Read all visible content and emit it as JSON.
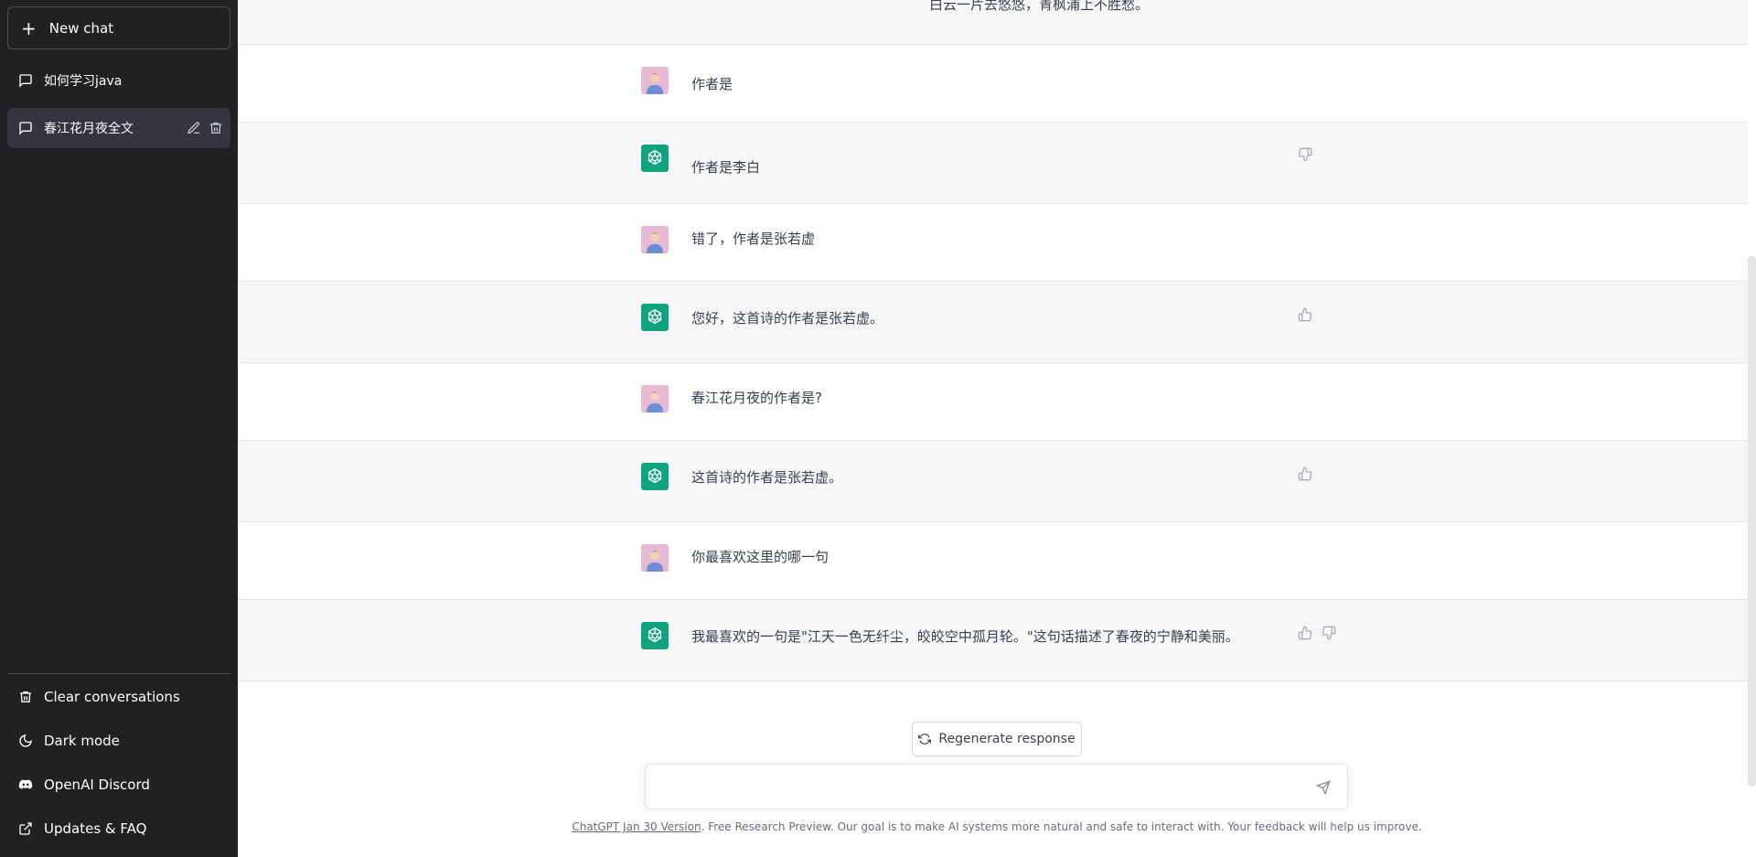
{
  "sidebar": {
    "new_chat_label": "New chat",
    "conversations": [
      {
        "label": "如何学习java"
      },
      {
        "label": "春江花月夜全文"
      }
    ],
    "bottom": [
      {
        "label": "Clear conversations",
        "icon": "trash-icon"
      },
      {
        "label": "Dark mode",
        "icon": "moon-icon"
      },
      {
        "label": "OpenAI Discord",
        "icon": "discord-icon"
      },
      {
        "label": "Updates & FAQ",
        "icon": "external-link-icon"
      }
    ]
  },
  "messages": [
    {
      "role": "user",
      "text": "作者是"
    },
    {
      "role": "assistant",
      "text": "作者是李白"
    },
    {
      "role": "user",
      "text": "错了，作者是张若虚"
    },
    {
      "role": "assistant",
      "text": "您好，这首诗的作者是张若虚。"
    },
    {
      "role": "user",
      "text": "春江花月夜的作者是?"
    },
    {
      "role": "assistant",
      "text": "这首诗的作者是张若虚。"
    },
    {
      "role": "user",
      "text": "你最喜欢这里的哪一句"
    },
    {
      "role": "assistant",
      "text": "我最喜欢的一句是\"江天一色无纤尘，皎皎空中孤月轮。\"这句话描述了春夜的宁静和美丽。"
    }
  ],
  "partial_top_text": "白云一片去悠悠，青枫浦上不胜愁。",
  "regenerate_label": "Regenerate response",
  "input": {
    "placeholder": ""
  },
  "footer": {
    "link_text": "ChatGPT Jan 30 Version",
    "text": ". Free Research Preview. Our goal is to make AI systems more natural and safe to interact with. Your feedback will help us improve."
  },
  "colors": {
    "sidebar_bg": "#202123",
    "active_item": "#343541",
    "brand": "#10a37f",
    "bot_row": "#f7f7f8"
  }
}
